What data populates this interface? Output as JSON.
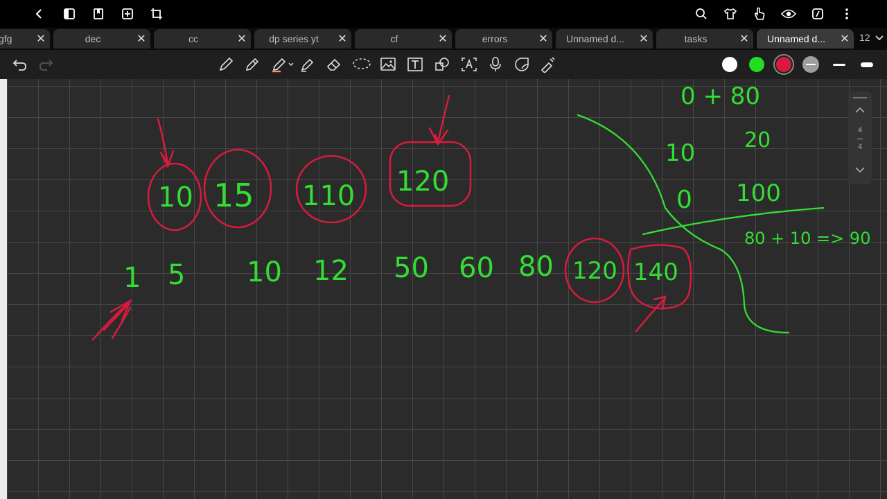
{
  "tabs": [
    {
      "label": "gfg"
    },
    {
      "label": "dec"
    },
    {
      "label": "cc"
    },
    {
      "label": "dp series yt"
    },
    {
      "label": "cf"
    },
    {
      "label": "errors"
    },
    {
      "label": "Unnamed d..."
    },
    {
      "label": "tasks"
    },
    {
      "label": "Unnamed d..."
    }
  ],
  "tab_count": "12",
  "pager": {
    "current": "4",
    "total": "4"
  },
  "colors": {
    "pen_green": "#33dd33",
    "pen_red": "#d81b3c",
    "swatch_white": "#ffffff",
    "swatch_green": "#22dd22",
    "swatch_red": "#d81b3c",
    "swatch_gray": "#9e9e9e"
  },
  "ink": {
    "circled_top": [
      "10",
      "15",
      "110",
      "120"
    ],
    "row": [
      "1",
      "5",
      "10",
      "12",
      "50",
      "60",
      "80",
      "120",
      "140"
    ],
    "right": [
      "0 + 80",
      "10",
      "20",
      "0",
      "100",
      "80 + 10 => 90"
    ]
  }
}
